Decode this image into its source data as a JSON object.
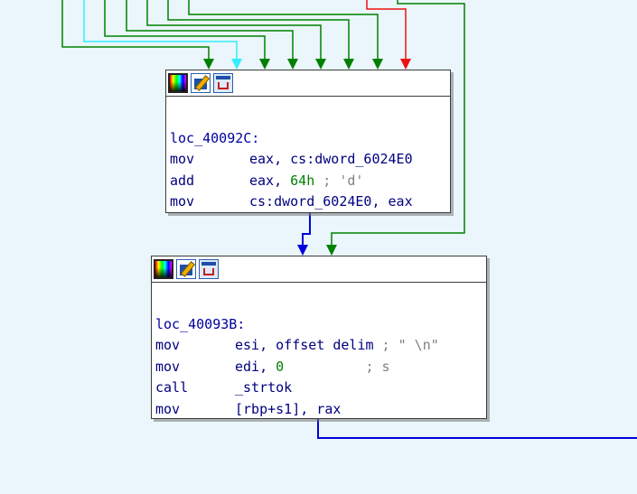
{
  "colors": {
    "background": "#eaf6fb",
    "edge_green": "#008000",
    "edge_cyan": "#33eeff",
    "edge_red": "#ee1111",
    "edge_blue": "#0000dd"
  },
  "nodes": [
    {
      "label": "loc_40092C:",
      "lines": [
        {
          "mnem": "mov",
          "op": "eax, cs:dword_6024E0"
        },
        {
          "mnem": "add",
          "op_a": "eax, ",
          "num": "64h",
          "cmt": " ; 'd'"
        },
        {
          "mnem": "mov",
          "op": "cs:dword_6024E0, eax"
        }
      ]
    },
    {
      "label": "loc_40093B:",
      "lines": [
        {
          "mnem": "mov",
          "op": "esi, offset delim",
          "cmt": " ; \" \\n\""
        },
        {
          "mnem": "mov",
          "op_a": "edi, ",
          "num": "0",
          "cmt": "          ; s"
        },
        {
          "mnem": "call",
          "op": "_strtok"
        },
        {
          "mnem": "mov",
          "op": "[rbp+s1], rax"
        }
      ]
    }
  ],
  "toolbar_icons": [
    "palette-icon",
    "rename-icon",
    "graph-icon"
  ]
}
